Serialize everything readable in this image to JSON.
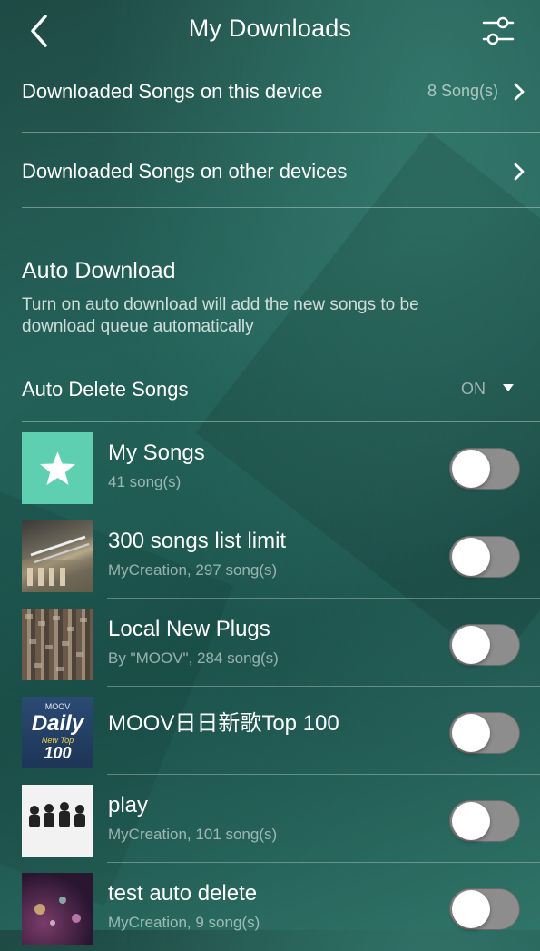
{
  "header": {
    "title": "My Downloads",
    "back_icon": "chevron-left-icon",
    "settings_icon": "sliders-icon"
  },
  "downloads": {
    "this_device": {
      "label": "Downloaded Songs on this device",
      "count": "8 Song(s)"
    },
    "other_devices": {
      "label": "Downloaded Songs on other devices"
    }
  },
  "auto_download": {
    "title": "Auto Download",
    "description": "Turn on auto download will add the new songs to be download queue automatically",
    "auto_delete": {
      "label": "Auto Delete Songs",
      "value": "ON"
    }
  },
  "playlists": [
    {
      "name": "My Songs",
      "meta": "41 song(s)",
      "enabled": false,
      "thumb": "star-icon"
    },
    {
      "name": "300 songs list limit",
      "meta": "MyCreation, 297 song(s)",
      "enabled": false,
      "thumb": "photo"
    },
    {
      "name": "Local New Plugs",
      "meta": "By \"MOOV\", 284 song(s)",
      "enabled": false,
      "thumb": "photo"
    },
    {
      "name": "MOOV日日新歌Top 100",
      "meta": "",
      "enabled": false,
      "thumb": "daily-cover",
      "cover_text": {
        "brand": "MOOV",
        "big": "Daily",
        "sub": "New Top",
        "num": "100"
      }
    },
    {
      "name": "play",
      "meta": "MyCreation, 101 song(s)",
      "enabled": false,
      "thumb": "photo"
    },
    {
      "name": "test auto delete",
      "meta": "MyCreation, 9 song(s)",
      "enabled": false,
      "thumb": "photo"
    }
  ],
  "colors": {
    "accent_teal": "#5ecfb0",
    "toggle_off": "#8d8d8d",
    "background": "#27625a"
  }
}
